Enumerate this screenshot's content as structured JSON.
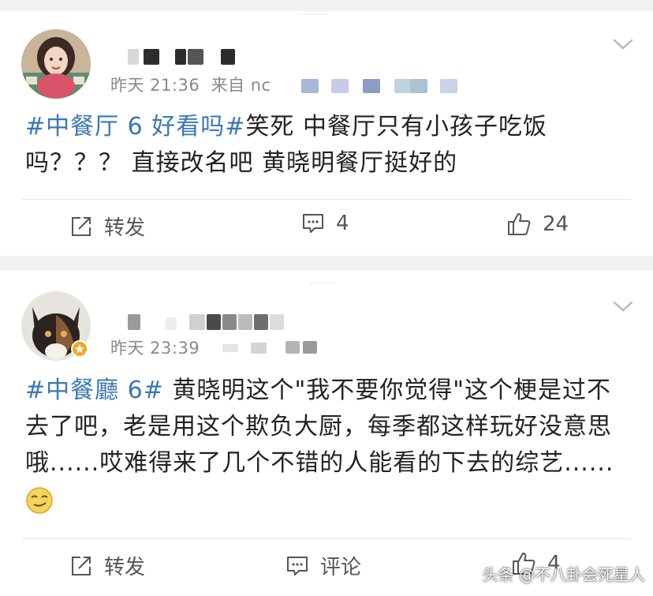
{
  "posts": [
    {
      "time": "昨天 21:36",
      "source": "来自 nc",
      "topic": "#中餐厅 6 好看吗#",
      "body": "笑死 中餐厅只有小孩子吃饭吗？？？ 直接改名吧 黄晓明餐厅挺好的",
      "actions": {
        "repost": "转发",
        "comments": "4",
        "likes": "24"
      }
    },
    {
      "time": "昨天 23:39",
      "topic": "#中餐廳 6#",
      "body": " 黄晓明这个\"我不要你觉得\"这个梗是过不去了吧，老是用这个欺负大厨，每季都这样玩好没意思哦......哎难得来了几个不错的人能看的下去的综艺......",
      "actions": {
        "repost": "转发",
        "comments": "评论",
        "likes": "4"
      }
    }
  ],
  "watermark": "头条 @不八卦会死星人",
  "icons": {
    "repost": "repost-icon",
    "comment": "comment-icon",
    "like": "thumbs-up-icon",
    "menu": "chevron-down-icon",
    "verified": "verified-badge-icon",
    "emoji": "smirk-emoji-icon"
  },
  "colors": {
    "topic": "#3a77b6",
    "text": "#222222",
    "meta": "#8a8a8a",
    "page_bg": "#f2f2f2"
  }
}
